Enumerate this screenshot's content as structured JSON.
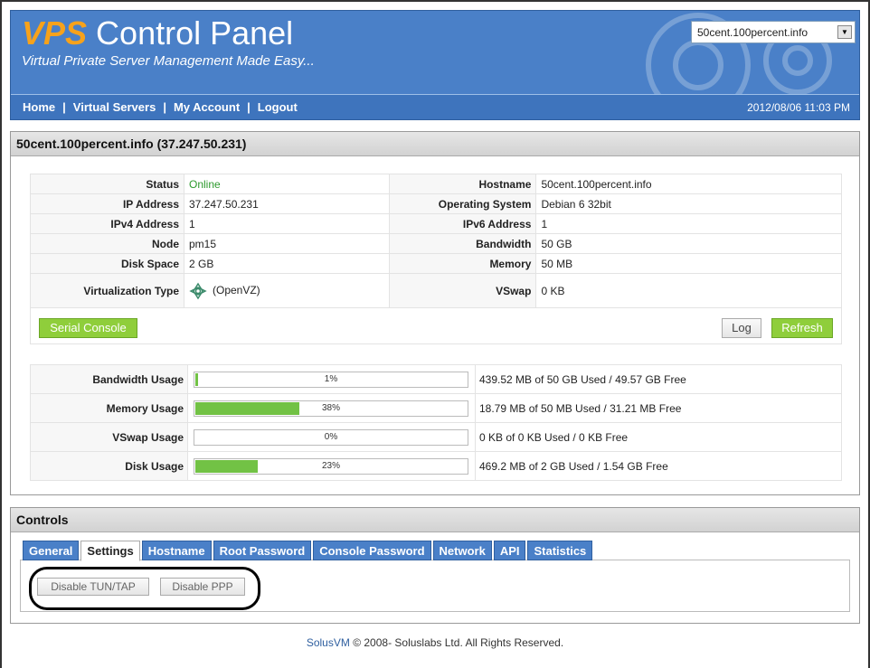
{
  "header": {
    "brand_vps": "VPS",
    "brand_rest": " Control Panel",
    "tagline": "Virtual Private Server Management Made Easy...",
    "server_select": "50cent.100percent.info"
  },
  "nav": {
    "home": "Home",
    "virtual_servers": "Virtual Servers",
    "my_account": "My Account",
    "logout": "Logout",
    "sep": "|",
    "datetime": "2012/08/06 11:03 PM"
  },
  "server": {
    "title": "50cent.100percent.info (37.247.50.231)",
    "left": [
      {
        "label": "Status",
        "value": "Online"
      },
      {
        "label": "IP Address",
        "value": "37.247.50.231"
      },
      {
        "label": "IPv4 Address",
        "value": "1"
      },
      {
        "label": "Node",
        "value": "pm15"
      },
      {
        "label": "Disk Space",
        "value": "2 GB"
      },
      {
        "label": "Virtualization Type",
        "value": "(OpenVZ)"
      }
    ],
    "right": [
      {
        "label": "Hostname",
        "value": "50cent.100percent.info"
      },
      {
        "label": "Operating System",
        "value": "Debian 6 32bit"
      },
      {
        "label": "IPv6 Address",
        "value": "1"
      },
      {
        "label": "Bandwidth",
        "value": "50 GB"
      },
      {
        "label": "Memory",
        "value": "50 MB"
      },
      {
        "label": "VSwap",
        "value": "0 KB"
      }
    ],
    "buttons": {
      "serial_console": "Serial Console",
      "log": "Log",
      "refresh": "Refresh"
    }
  },
  "usage": [
    {
      "label": "Bandwidth Usage",
      "percent": 1,
      "percent_text": "1%",
      "detail": "439.52 MB of 50 GB Used / 49.57 GB Free"
    },
    {
      "label": "Memory Usage",
      "percent": 38,
      "percent_text": "38%",
      "detail": "18.79 MB of 50 MB Used / 31.21 MB Free"
    },
    {
      "label": "VSwap Usage",
      "percent": 0,
      "percent_text": "0%",
      "detail": "0 KB of 0 KB Used / 0 KB Free"
    },
    {
      "label": "Disk Usage",
      "percent": 23,
      "percent_text": "23%",
      "detail": "469.2 MB of 2 GB Used / 1.54 GB Free"
    }
  ],
  "controls": {
    "title": "Controls",
    "tabs": [
      "General",
      "Settings",
      "Hostname",
      "Root Password",
      "Console Password",
      "Network",
      "API",
      "Statistics"
    ],
    "active_tab": "Settings",
    "buttons": {
      "disable_tun_tap": "Disable TUN/TAP",
      "disable_ppp": "Disable PPP"
    }
  },
  "footer": {
    "link": "SolusVM",
    "text": " © 2008- Soluslabs Ltd. All Rights Reserved."
  },
  "colors": {
    "header_blue": "#4a80c8",
    "accent_orange": "#f7a21b",
    "button_green": "#8fce3b",
    "bar_green": "#72c245",
    "online_green": "#2d9a2d"
  }
}
